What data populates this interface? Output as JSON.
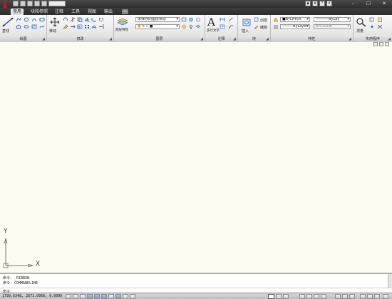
{
  "titlebar": {
    "workspace": "",
    "window_controls": [
      "–",
      "☐",
      "✕"
    ]
  },
  "ribbon_tabs": [
    "常用",
    "块和参照",
    "注释",
    "工具",
    "视图",
    "输出"
  ],
  "panels": {
    "draw": {
      "title": "绘图",
      "line_label": "直线"
    },
    "modify": {
      "title": "修改",
      "move_label": "移动"
    },
    "layers": {
      "title": "图层",
      "layer_state": "未保存的图层状态",
      "layer_props_label": "图层特性"
    },
    "annotation": {
      "title": "注释",
      "text_label": "多行文字"
    },
    "block": {
      "title": "块",
      "insert_label": "插入",
      "create_label": "创建",
      "edit_label": "编辑"
    },
    "properties": {
      "title": "特性",
      "color": "BYLAYER",
      "linetype": "ByLay",
      "lineweight": "ByLayer",
      "plotstyle": "BYCOLOR"
    },
    "utilities": {
      "title": "实用程序",
      "measure_label": "测量"
    }
  },
  "ucs": {
    "x": "X",
    "y": "Y"
  },
  "command_history": [
    "命令:  _RIBBON",
    "命令:  COMMANDLINE"
  ],
  "command_prompt": "命令:",
  "status": {
    "coords": "1799.6348, 2671.0966, 0.0000"
  },
  "colors": {
    "accent": "#c8102e",
    "canvas": "#fcfbf0",
    "ribbon_dark": "#2f2f2f"
  }
}
